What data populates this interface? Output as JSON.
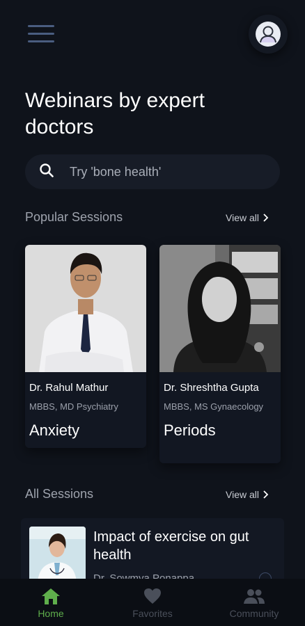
{
  "header": {
    "menu_icon": "hamburger-menu-icon",
    "profile_icon": "user-avatar-icon"
  },
  "page": {
    "title": "Webinars by expert doctors"
  },
  "search": {
    "placeholder": "Try 'bone health'",
    "icon": "search-icon"
  },
  "popular": {
    "title": "Popular Sessions",
    "view_all": "View all",
    "cards": [
      {
        "doctor": "Dr. Rahul Mathur",
        "degree": "MBBS, MD Psychiatry",
        "topic": "Anxiety"
      },
      {
        "doctor": "Dr. Shreshtha Gupta",
        "degree": "MBBS, MS Gynaecology",
        "topic": "Periods"
      }
    ]
  },
  "all_sessions": {
    "title": "All Sessions",
    "view_all": "View all",
    "items": [
      {
        "title": "Impact of exercise on gut health",
        "doctor": "Dr. Sowmya Ponappa"
      }
    ]
  },
  "nav": {
    "items": [
      {
        "label": "Home",
        "icon": "home-icon",
        "active": true
      },
      {
        "label": "Favorites",
        "icon": "heart-icon",
        "active": false
      },
      {
        "label": "Community",
        "icon": "people-icon",
        "active": false
      }
    ]
  },
  "colors": {
    "background": "#0f131b",
    "card": "#121722",
    "active_nav": "#5fae4c",
    "inactive_nav": "#4a4f5a"
  }
}
